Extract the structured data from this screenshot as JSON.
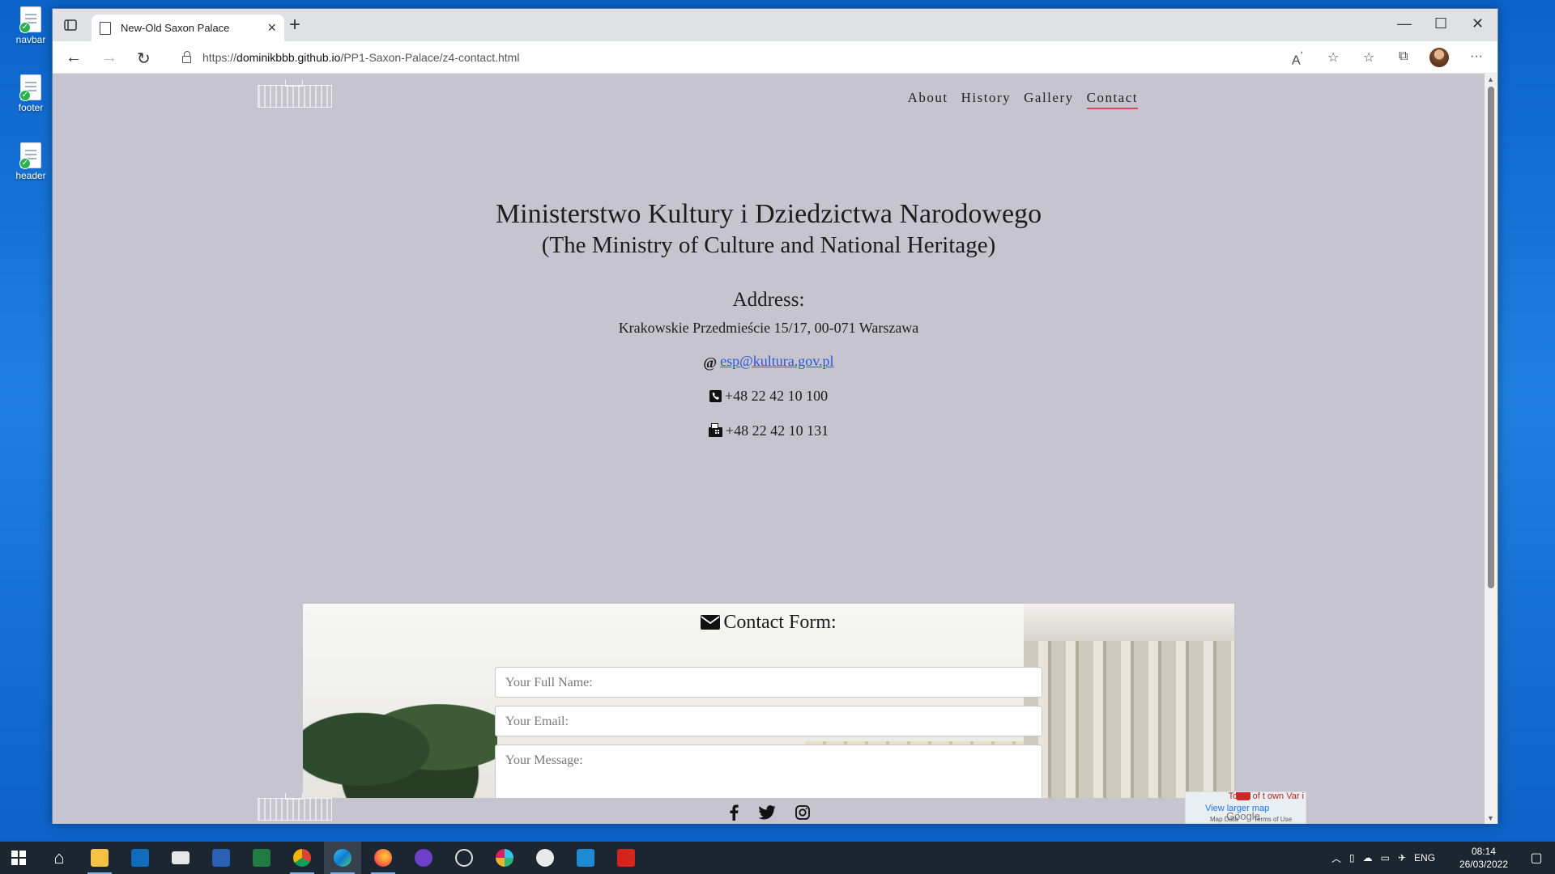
{
  "desktop": {
    "icons": [
      {
        "label": "navbar"
      },
      {
        "label": "footer"
      },
      {
        "label": "header"
      }
    ]
  },
  "browser": {
    "tab_title": "New-Old Saxon Palace",
    "url_prefix": "https://",
    "url_host": "dominikbbb.github.io",
    "url_path": "/PP1-Saxon-Palace/z4-contact.html"
  },
  "site": {
    "nav": [
      {
        "label": "About"
      },
      {
        "label": "History"
      },
      {
        "label": "Gallery"
      },
      {
        "label": "Contact",
        "active": true
      }
    ],
    "heading": "Ministerstwo Kultury i Dziedzictwa Narodowego",
    "subheading": "(The Ministry of Culture and National Heritage)",
    "address_title": "Address:",
    "address": "Krakowskie Przedmieście 15/17, 00-071 Warszawa",
    "email": "esp@kultura.gov.pl",
    "phone": "+48 22 42 10 100",
    "fax": "+48 22 42 10 131",
    "form": {
      "title": "Contact Form:",
      "name_placeholder": "Your Full Name:",
      "email_placeholder": "Your Email:",
      "message_placeholder": "Your Message:"
    },
    "map": {
      "link": "View larger map",
      "map_data": "Map Data",
      "terms": "Terms of Use",
      "brand": "Google",
      "label_fragment": "Tomb of t own Var i"
    }
  },
  "taskbar": {
    "lang": "ENG",
    "time": "08:14",
    "date": "26/03/2022"
  },
  "colors": {
    "page_bg": "#c5c4cf",
    "nav_active_underline": "#d94a5a",
    "link": "#2a57d8"
  }
}
